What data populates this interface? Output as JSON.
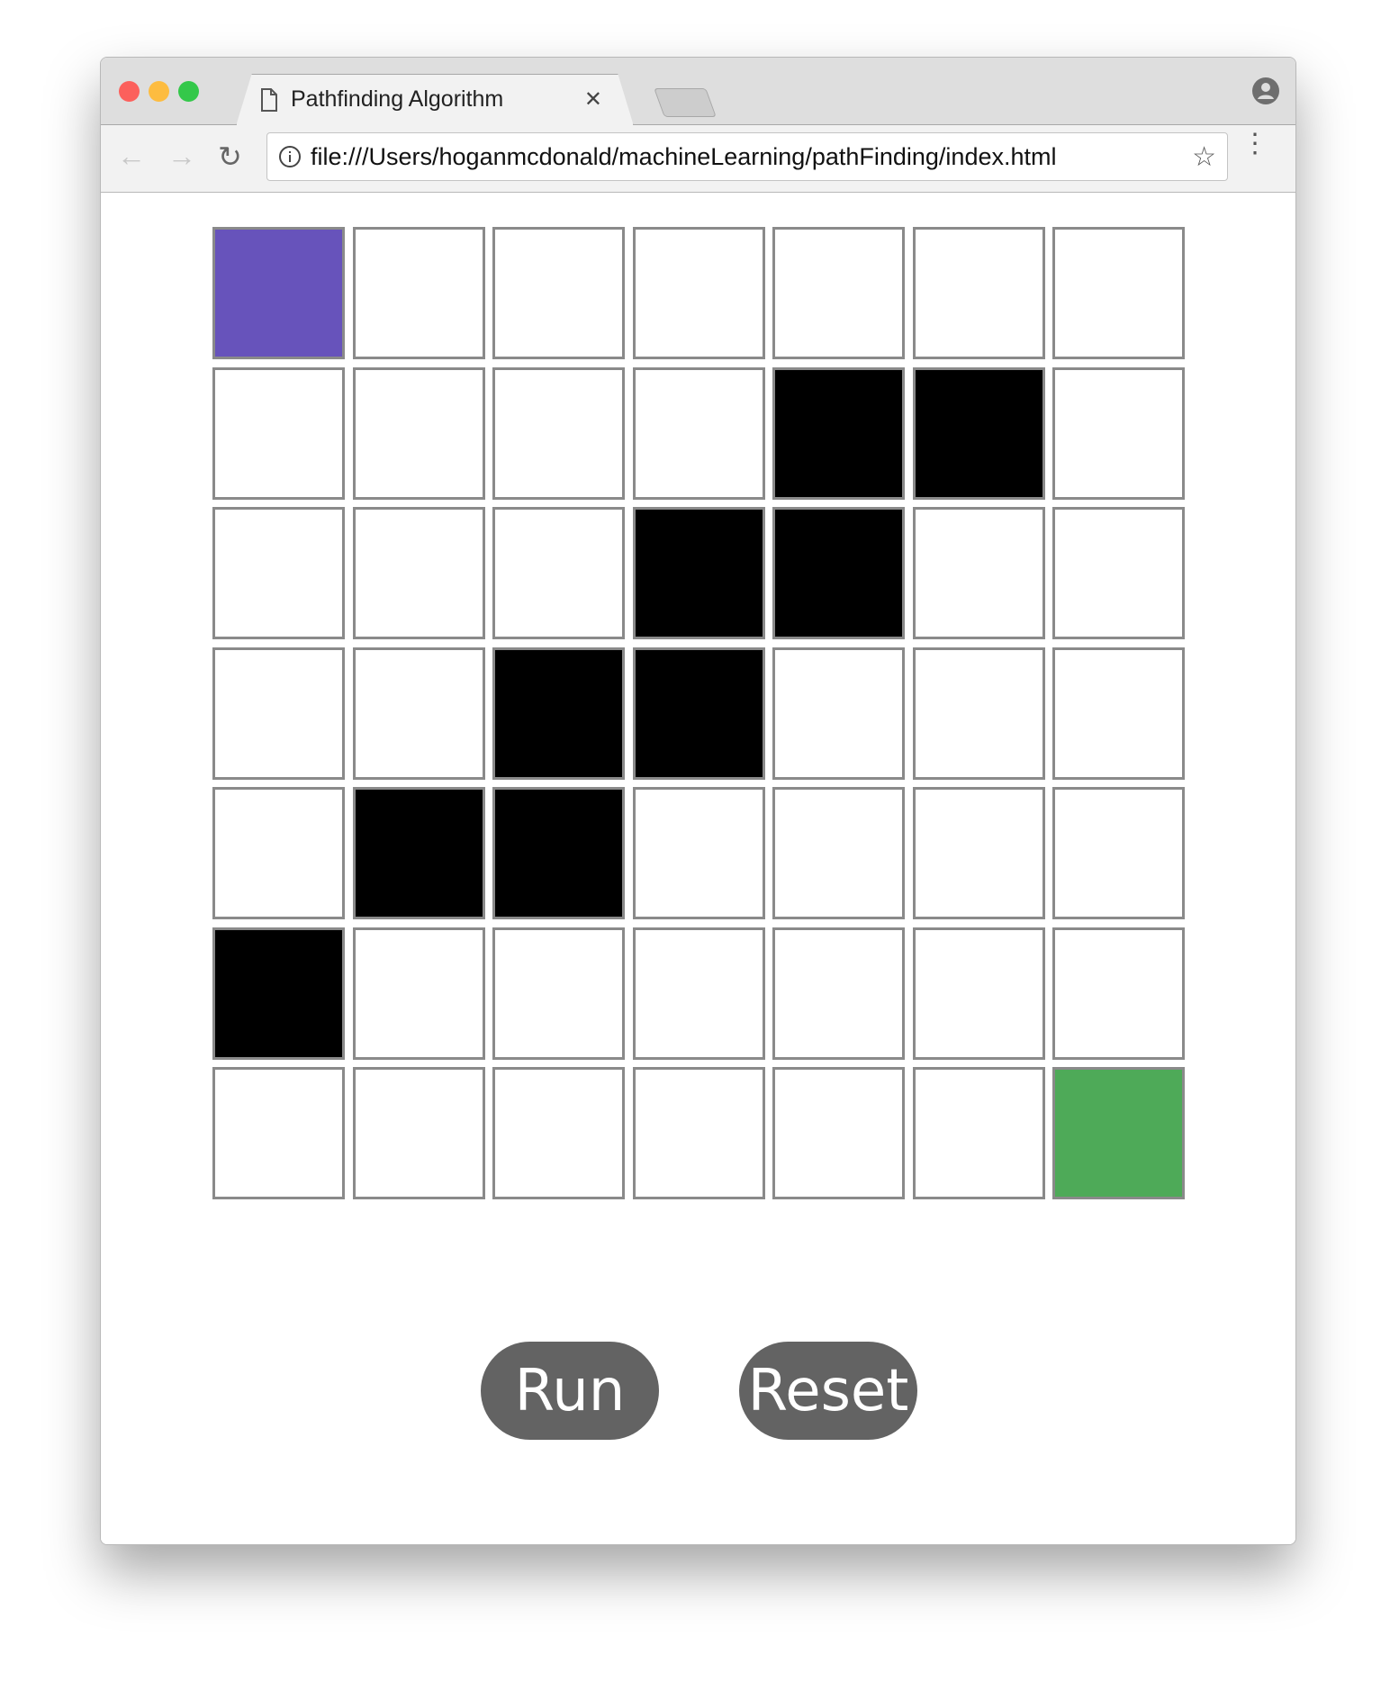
{
  "browser": {
    "tab_title": "Pathfinding Algorithm",
    "url": "file:///Users/hoganmcdonald/machineLearning/pathFinding/index.html",
    "icons": [
      "close-icon",
      "red-light",
      "yellow-light",
      "green-light",
      "document-icon",
      "profile-icon",
      "back-icon",
      "forward-icon",
      "reload-icon",
      "info-icon",
      "star-icon",
      "menu-icon"
    ]
  },
  "grid": {
    "rows": 7,
    "cols": 7,
    "start": [
      0,
      0
    ],
    "end": [
      6,
      6
    ],
    "walls": [
      [
        1,
        4
      ],
      [
        1,
        5
      ],
      [
        2,
        3
      ],
      [
        2,
        4
      ],
      [
        3,
        2
      ],
      [
        3,
        3
      ],
      [
        4,
        1
      ],
      [
        4,
        2
      ],
      [
        5,
        0
      ]
    ],
    "colors": {
      "start": "#6753bb",
      "end": "#4eaa58",
      "wall": "#000000",
      "empty": "#ffffff",
      "border": "#8a8a8a"
    }
  },
  "buttons": {
    "run": "Run",
    "reset": "Reset"
  }
}
